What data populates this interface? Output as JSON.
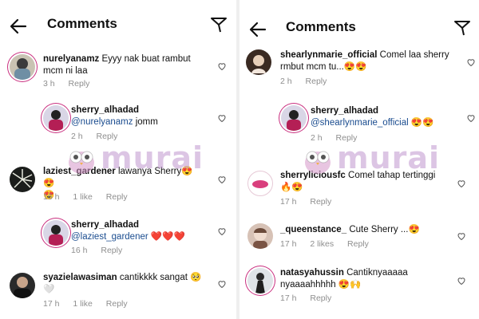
{
  "left": {
    "title": "Comments",
    "comments": [
      {
        "user": "nurelyanamz",
        "text": "Eyyy nak buat rambut mcm ni laa",
        "time": "3 h",
        "reply": "Reply"
      },
      {
        "user": "sherry_alhadad",
        "mention": "@nurelyanamz",
        "text": "jomm",
        "time": "2 h",
        "reply": "Reply"
      },
      {
        "user": "laziest_gardener",
        "text": "lawanya Sherry😍😍",
        "text2": "😍",
        "time": "16 h",
        "likes": "1 like",
        "reply": "Reply"
      },
      {
        "user": "sherry_alhadad",
        "mention": "@laziest_gardener",
        "text": "❤️❤️❤️",
        "time": "16 h",
        "reply": "Reply"
      },
      {
        "user": "syazielawasiman",
        "text": "cantikkkk sangat 🥺",
        "text2": "🤍",
        "time": "17 h",
        "likes": "1 like",
        "reply": "Reply"
      }
    ]
  },
  "right": {
    "title": "Comments",
    "comments": [
      {
        "user": "shearlynmarie_official",
        "text": "Comel laa sherry",
        "text2": "rmbut mcm tu...😍😍",
        "time": "2 h",
        "reply": "Reply"
      },
      {
        "user": "sherry_alhadad",
        "mention": "@shearlynmarie_official",
        "text": "😍😍",
        "time": "2 h",
        "reply": "Reply"
      },
      {
        "user": "sherryliciousfc",
        "text": "Comel tahap tertinggi",
        "text2": "🔥😍",
        "time": "17 h",
        "reply": "Reply"
      },
      {
        "user": "_queenstance_",
        "text": "Cute Sherry ...😍",
        "time": "17 h",
        "likes": "2 likes",
        "reply": "Reply"
      },
      {
        "user": "natasyahussin",
        "text": "Cantiknyaaaaa",
        "text2": "nyaaaahhhhh 😍🙌",
        "time": "17 h",
        "reply": "Reply"
      }
    ]
  },
  "watermark": {
    "text": "murai"
  },
  "colors": {
    "mention": "#1a4c8f",
    "meta": "#8e8e8e",
    "ring": "#c92f7f",
    "watermark": "#c096cd"
  }
}
